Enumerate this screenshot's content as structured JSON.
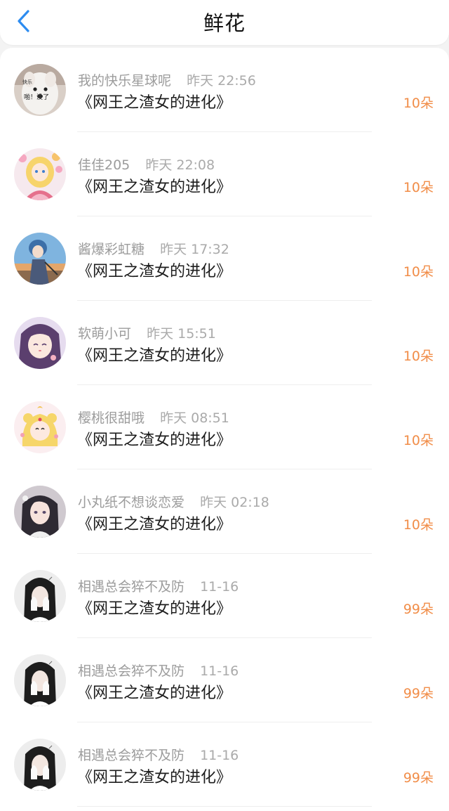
{
  "header": {
    "title": "鲜花",
    "back_icon": "chevron-left-icon",
    "accent": "#2d8cf0"
  },
  "list": {
    "items": [
      {
        "name": "我的快乐星球呢",
        "time": "昨天 22:56",
        "book": "《网王之渣女的进化》",
        "count": "10朵",
        "avatar_label_1": "快乐",
        "avatar_label_2": "啪！没了"
      },
      {
        "name": "佳佳205",
        "time": "昨天 22:08",
        "book": "《网王之渣女的进化》",
        "count": "10朵"
      },
      {
        "name": "酱爆彩虹糖",
        "time": "昨天 17:32",
        "book": "《网王之渣女的进化》",
        "count": "10朵"
      },
      {
        "name": "软萌小可",
        "time": "昨天 15:51",
        "book": "《网王之渣女的进化》",
        "count": "10朵"
      },
      {
        "name": "樱桃很甜哦",
        "time": "昨天 08:51",
        "book": "《网王之渣女的进化》",
        "count": "10朵"
      },
      {
        "name": "小丸纸不想谈恋爱",
        "time": "昨天 02:18",
        "book": "《网王之渣女的进化》",
        "count": "10朵"
      },
      {
        "name": "相遇总会猝不及防",
        "time": "11-16",
        "book": "《网王之渣女的进化》",
        "count": "99朵"
      },
      {
        "name": "相遇总会猝不及防",
        "time": "11-16",
        "book": "《网王之渣女的进化》",
        "count": "99朵"
      },
      {
        "name": "相遇总会猝不及防",
        "time": "11-16",
        "book": "《网王之渣女的进化》",
        "count": "99朵"
      }
    ]
  },
  "colors": {
    "count": "#f18d48",
    "name": "#9c9c9c",
    "book": "#1d1d1d"
  }
}
